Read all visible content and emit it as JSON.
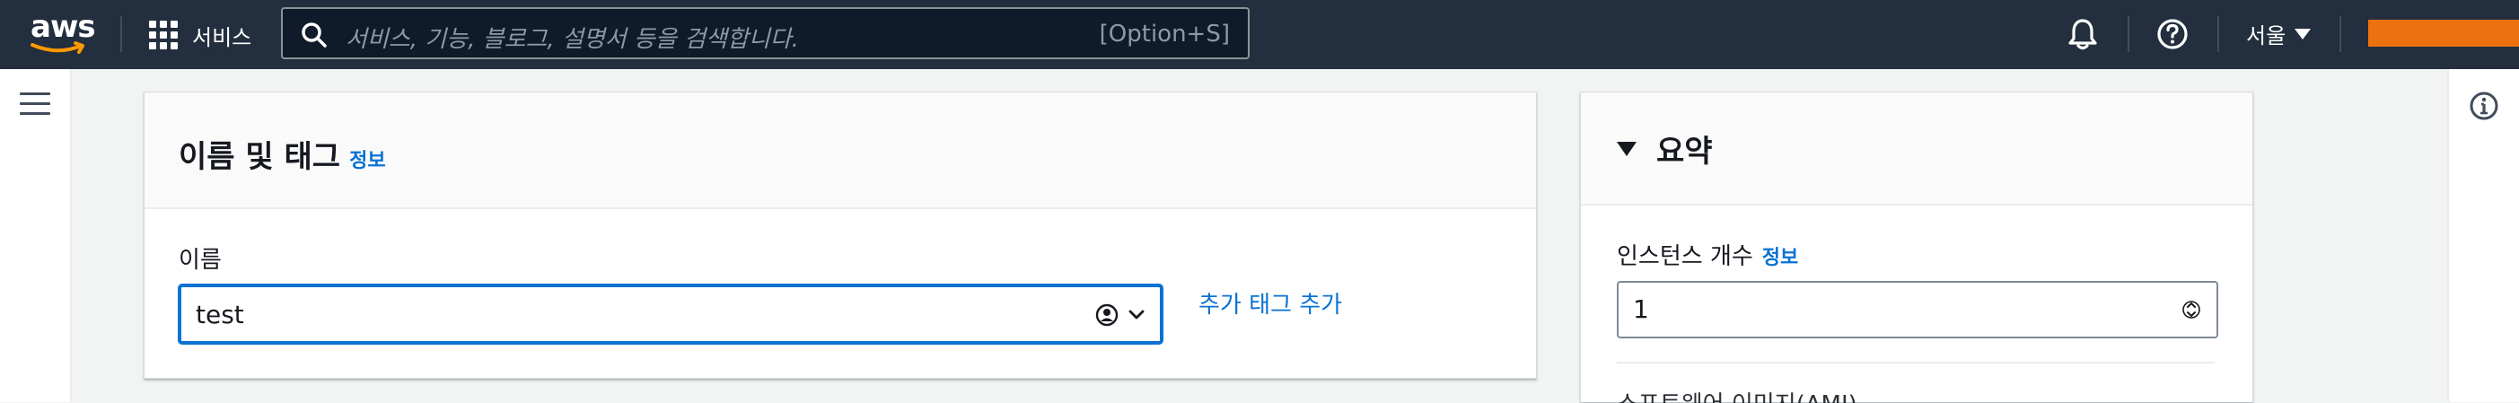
{
  "nav": {
    "logo_text": "aws",
    "services_label": "서비스",
    "search_placeholder": "서비스, 기능, 블로그, 설명서 등을 검색합니다.",
    "search_shortcut": "[Option+S]",
    "region_label": "서울",
    "accent_color": "#ec7211",
    "icons": [
      "grid-icon",
      "search-icon",
      "bell-icon",
      "help-icon",
      "chevron-down-icon"
    ]
  },
  "main_panel": {
    "title": "이름 및 태그",
    "info_link": "정보",
    "name_label": "이름",
    "name_value": "test",
    "add_tag_link": "추가 태그 추가"
  },
  "summary": {
    "title": "요약",
    "instance_count_label": "인스턴스 개수",
    "info_link": "정보",
    "instance_count_value": "1",
    "next_section_partial": "소프트웨어 이미지(AMI)"
  },
  "colors": {
    "nav_bg": "#232f3e",
    "link": "#0972d3",
    "focus": "#0972d3"
  }
}
